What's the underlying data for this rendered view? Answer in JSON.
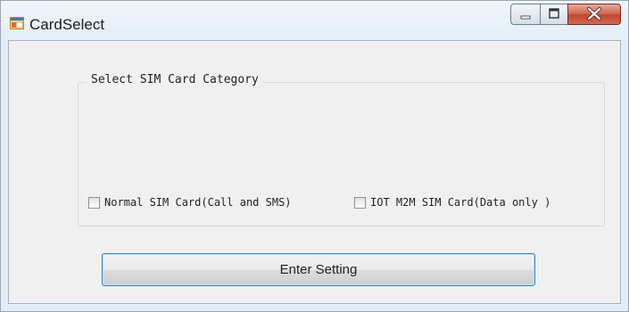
{
  "window": {
    "title": "CardSelect",
    "controls": [
      "minimize",
      "maximize",
      "close"
    ]
  },
  "group": {
    "title": "Select SIM Card Category",
    "options": [
      {
        "label": "Normal SIM Card(Call and SMS)",
        "checked": false
      },
      {
        "label": "IOT M2M SIM Card(Data only )",
        "checked": false
      }
    ]
  },
  "actions": {
    "enter_label": "Enter Setting"
  },
  "icons": {
    "app": "window-app-icon",
    "minimize": "minimize-icon",
    "maximize": "maximize-icon",
    "close": "close-icon"
  }
}
